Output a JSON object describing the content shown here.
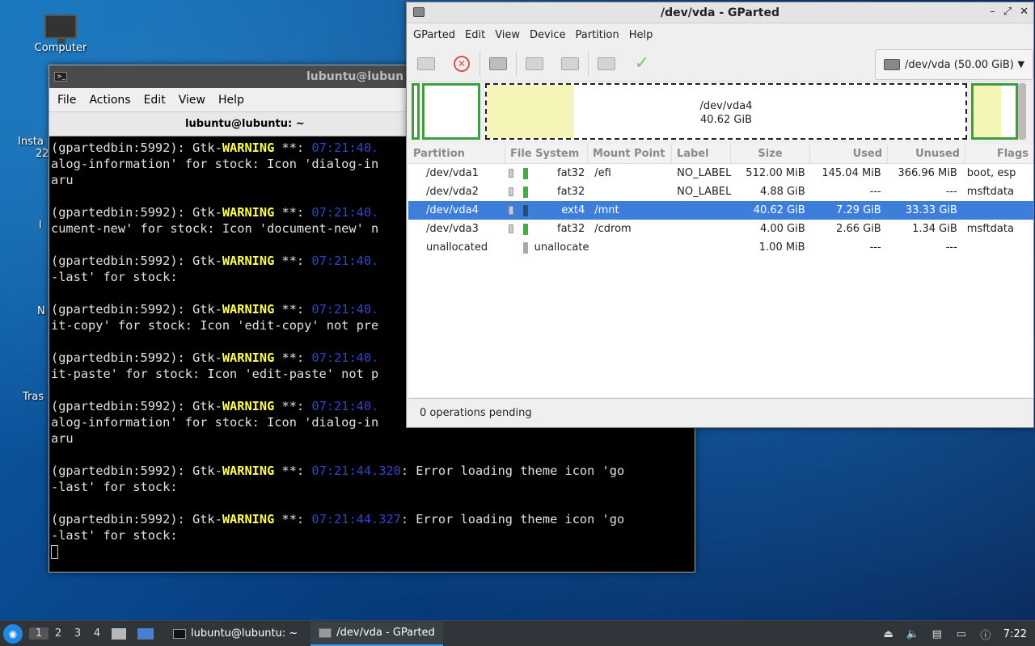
{
  "desktop": {
    "icons": [
      {
        "label": "Computer"
      },
      {
        "label": "Insta"
      },
      {
        "label": "22"
      },
      {
        "label": "l"
      },
      {
        "label": "N"
      },
      {
        "label": "Tras"
      }
    ]
  },
  "terminal": {
    "title": "lubuntu@lubun",
    "menu": [
      "File",
      "Actions",
      "Edit",
      "View",
      "Help"
    ],
    "tab_label": "lubuntu@lubuntu: ~",
    "lines": [
      {
        "pre": "(gpartedbin:5992): Gtk-",
        "warn": "WARNING",
        "mid": " **: ",
        "time": "07:21:40.",
        "post": ""
      },
      {
        "pre": "alog-information' for stock: Icon 'dialog-in",
        "warn": "",
        "mid": "",
        "time": "",
        "post": ""
      },
      {
        "pre": "aru",
        "warn": "",
        "mid": "",
        "time": "",
        "post": ""
      },
      {
        "pre": "",
        "warn": "",
        "mid": "",
        "time": "",
        "post": ""
      },
      {
        "pre": "(gpartedbin:5992): Gtk-",
        "warn": "WARNING",
        "mid": " **: ",
        "time": "07:21:40.",
        "post": ""
      },
      {
        "pre": "cument-new' for stock: Icon 'document-new' n",
        "warn": "",
        "mid": "",
        "time": "",
        "post": ""
      },
      {
        "pre": "",
        "warn": "",
        "mid": "",
        "time": "",
        "post": ""
      },
      {
        "pre": "(gpartedbin:5992): Gtk-",
        "warn": "WARNING",
        "mid": " **: ",
        "time": "07:21:40.",
        "post": ""
      },
      {
        "pre": "-last' for stock:",
        "warn": "",
        "mid": "",
        "time": "",
        "post": ""
      },
      {
        "pre": "",
        "warn": "",
        "mid": "",
        "time": "",
        "post": ""
      },
      {
        "pre": "(gpartedbin:5992): Gtk-",
        "warn": "WARNING",
        "mid": " **: ",
        "time": "07:21:40.",
        "post": ""
      },
      {
        "pre": "it-copy' for stock: Icon 'edit-copy' not pre",
        "warn": "",
        "mid": "",
        "time": "",
        "post": ""
      },
      {
        "pre": "",
        "warn": "",
        "mid": "",
        "time": "",
        "post": ""
      },
      {
        "pre": "(gpartedbin:5992): Gtk-",
        "warn": "WARNING",
        "mid": " **: ",
        "time": "07:21:40.",
        "post": ""
      },
      {
        "pre": "it-paste' for stock: Icon 'edit-paste' not p",
        "warn": "",
        "mid": "",
        "time": "",
        "post": ""
      },
      {
        "pre": "",
        "warn": "",
        "mid": "",
        "time": "",
        "post": ""
      },
      {
        "pre": "(gpartedbin:5992): Gtk-",
        "warn": "WARNING",
        "mid": " **: ",
        "time": "07:21:40.",
        "post": ""
      },
      {
        "pre": "alog-information' for stock: Icon 'dialog-in",
        "warn": "",
        "mid": "",
        "time": "",
        "post": ""
      },
      {
        "pre": "aru",
        "warn": "",
        "mid": "",
        "time": "",
        "post": ""
      },
      {
        "pre": "",
        "warn": "",
        "mid": "",
        "time": "",
        "post": ""
      },
      {
        "pre": "(gpartedbin:5992): Gtk-",
        "warn": "WARNING",
        "mid": " **: ",
        "time": "07:21:44.320",
        "post": ": Error loading theme icon 'go"
      },
      {
        "pre": "-last' for stock:",
        "warn": "",
        "mid": "",
        "time": "",
        "post": ""
      },
      {
        "pre": "",
        "warn": "",
        "mid": "",
        "time": "",
        "post": ""
      },
      {
        "pre": "(gpartedbin:5992): Gtk-",
        "warn": "WARNING",
        "mid": " **: ",
        "time": "07:21:44.327",
        "post": ": Error loading theme icon 'go"
      },
      {
        "pre": "-last' for stock:",
        "warn": "",
        "mid": "",
        "time": "",
        "post": ""
      }
    ]
  },
  "gparted": {
    "title": "/dev/vda - GParted",
    "window_buttons": [
      "–",
      "⤢",
      "✕"
    ],
    "menu": [
      "GParted",
      "Edit",
      "View",
      "Device",
      "Partition",
      "Help"
    ],
    "device_selector": "/dev/vda (50.00 GiB)",
    "visual": {
      "selected_name": "/dev/vda4",
      "selected_size": "40.62 GiB"
    },
    "columns": [
      "Partition",
      "File System",
      "Mount Point",
      "Label",
      "Size",
      "Used",
      "Unused",
      "Flags"
    ],
    "rows": [
      {
        "partition": "/dev/vda1",
        "fs": "fat32",
        "color": "#44aa44",
        "mount": "/efi",
        "label": "NO_LABEL",
        "size": "512.00 MiB",
        "used": "145.04 MiB",
        "unused": "366.96 MiB",
        "flags": "boot, esp",
        "selected": false,
        "lock": true
      },
      {
        "partition": "/dev/vda2",
        "fs": "fat32",
        "color": "#44aa44",
        "mount": "",
        "label": "NO_LABEL",
        "size": "4.88 GiB",
        "used": "---",
        "unused": "---",
        "flags": "msftdata",
        "selected": false,
        "lock": true
      },
      {
        "partition": "/dev/vda4",
        "fs": "ext4",
        "color": "#2a4a78",
        "mount": "/mnt",
        "label": "",
        "size": "40.62 GiB",
        "used": "7.29 GiB",
        "unused": "33.33 GiB",
        "flags": "",
        "selected": true,
        "lock": true
      },
      {
        "partition": "/dev/vda3",
        "fs": "fat32",
        "color": "#44aa44",
        "mount": "/cdrom",
        "label": "",
        "size": "4.00 GiB",
        "used": "2.66 GiB",
        "unused": "1.34 GiB",
        "flags": "msftdata",
        "selected": false,
        "lock": true
      },
      {
        "partition": "unallocated",
        "fs": "unallocated",
        "color": "#a8a8a8",
        "mount": "",
        "label": "",
        "size": "1.00 MiB",
        "used": "---",
        "unused": "---",
        "flags": "",
        "selected": false,
        "lock": false
      }
    ],
    "status": "0 operations pending"
  },
  "taskbar": {
    "workspaces": [
      "1",
      "2",
      "3",
      "4"
    ],
    "tasks": [
      {
        "label": "lubuntu@lubuntu: ~"
      },
      {
        "label": "/dev/vda - GParted"
      }
    ],
    "clock": "7:22"
  }
}
